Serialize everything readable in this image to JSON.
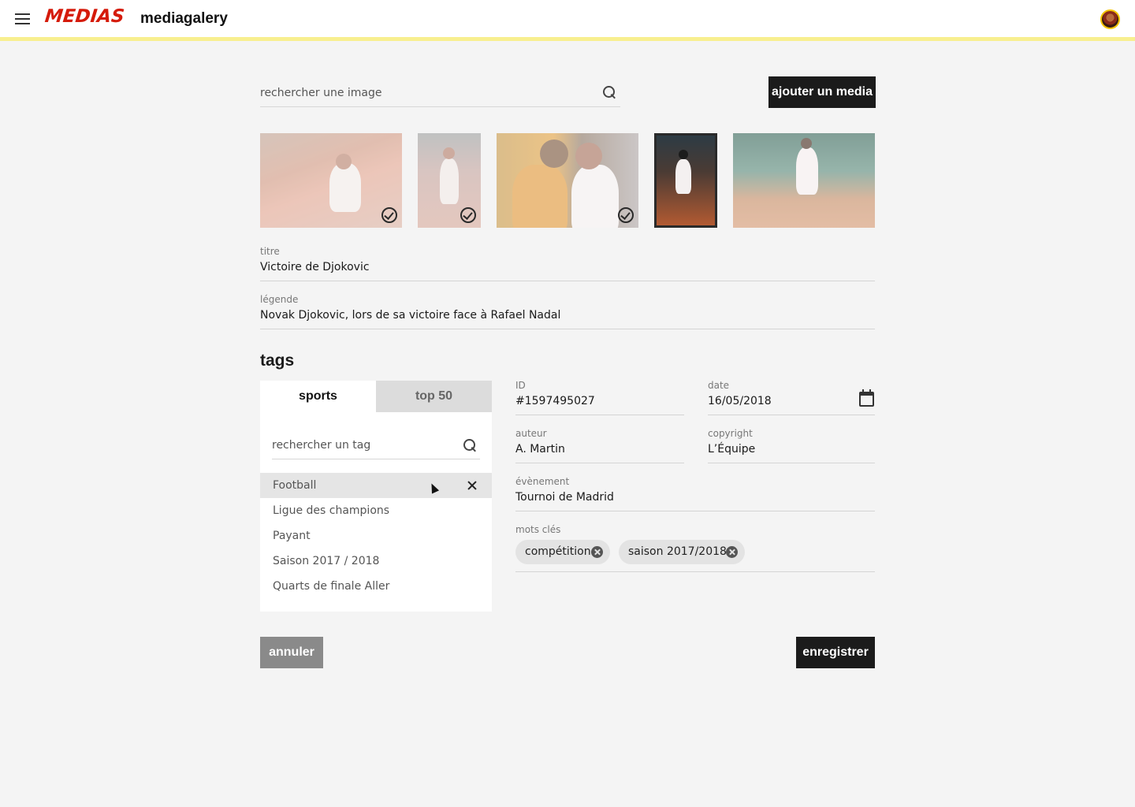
{
  "header": {
    "brand": "MEDIAS",
    "app_name": "mediagalery",
    "brand_color": "#d51b0b",
    "accent_line_color": "#f8ef8f"
  },
  "search": {
    "placeholder": "rechercher une image",
    "icon": "search-icon"
  },
  "toolbar": {
    "add_label": "ajouter un media"
  },
  "gallery": {
    "images": [
      {
        "name": "image-1",
        "selected": true
      },
      {
        "name": "image-2",
        "selected": true
      },
      {
        "name": "image-3",
        "selected": true
      },
      {
        "name": "image-4",
        "selected": false,
        "current": true
      },
      {
        "name": "image-5",
        "selected": false
      }
    ]
  },
  "form": {
    "title": {
      "label": "titre",
      "value": "Victoire de Djokovic"
    },
    "caption": {
      "label": "légende",
      "value": "Novak Djokovic, lors de sa victoire face à Rafael Nadal"
    },
    "id": {
      "label": "ID",
      "value": "#1597495027"
    },
    "date": {
      "label": "date",
      "value": "16/05/2018"
    },
    "author": {
      "label": "auteur",
      "value": "A. Martin"
    },
    "copyright": {
      "label": "copyright",
      "value": "L’Équipe"
    },
    "event": {
      "label": "évènement",
      "value": "Tournoi de Madrid"
    },
    "keywords": {
      "label": "mots clés",
      "chips": [
        "compétition",
        "saison 2017/2018"
      ]
    }
  },
  "tags": {
    "title": "tags",
    "tabs": [
      "sports",
      "top 50"
    ],
    "active_tab": "sports",
    "search_placeholder": "rechercher un tag",
    "items": [
      "Football",
      "Ligue des champions",
      "Payant",
      "Saison 2017 / 2018",
      "Quarts de finale Aller"
    ],
    "active_item": "Football"
  },
  "actions": {
    "cancel_label": "annuler",
    "save_label": "enregistrer"
  }
}
